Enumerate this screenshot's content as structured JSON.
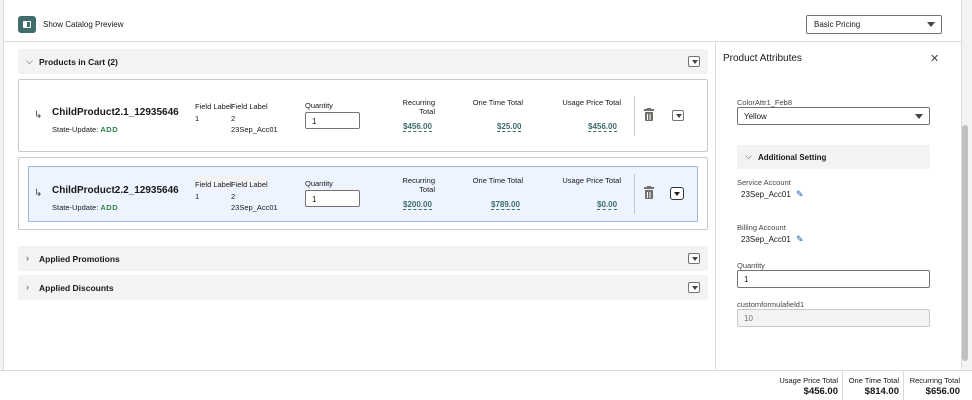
{
  "header": {
    "catalog_toggle_label": "Show Catalog Preview",
    "pricing_select_value": "Basic Pricing"
  },
  "sections": {
    "products_in_cart": "Products in Cart (2)",
    "applied_promotions": "Applied Promotions",
    "applied_discounts": "Applied Discounts"
  },
  "products": [
    {
      "name": "ChildProduct2.1_12935646",
      "state_label": "State-Update:",
      "state_value": "ADD",
      "field_label_1": "Field Label",
      "field_label_2": "Field Label",
      "field_value_1": "1",
      "field_value_2": "2",
      "field_value_3": "23Sep_Acc01",
      "quantity_label": "Quantity",
      "quantity": "1",
      "recurring_label": "Recurring Total",
      "recurring_total": "$456.00",
      "one_time_label": "One Time Total",
      "one_time_total": "$25.00",
      "usage_label": "Usage Price Total",
      "usage_total": "$456.00"
    },
    {
      "name": "ChildProduct2.2_12935646",
      "state_label": "State-Update:",
      "state_value": "ADD",
      "field_label_1": "Field Label",
      "field_label_2": "Field Label",
      "field_value_1": "1",
      "field_value_2": "2",
      "field_value_3": "23Sep_Acc01",
      "quantity_label": "Quantity",
      "quantity": "1",
      "recurring_label": "Recurring Total",
      "recurring_total": "$200.00",
      "one_time_label": "One Time Total",
      "one_time_total": "$789.00",
      "usage_label": "Usage Price Total",
      "usage_total": "$0.00"
    }
  ],
  "attributes": {
    "title": "Product Attributes",
    "color_label": "ColorAttr1_Feb8",
    "color_value": "Yellow",
    "additional_setting": "Additional Setting",
    "service_account_label": "Service Account",
    "service_account_value": "23Sep_Acc01",
    "billing_account_label": "Billing Account",
    "billing_account_value": "23Sep_Acc01",
    "quantity_label": "Quantity",
    "quantity_value": "1",
    "custom_field_label": "customformulafield1",
    "custom_field_value": "10"
  },
  "footer": {
    "usage_label": "Usage Price Total",
    "usage_value": "$456.00",
    "one_time_label": "One Time Total",
    "one_time_value": "$814.00",
    "recurring_label": "Recurring Total",
    "recurring_value": "$656.00"
  },
  "colors": {
    "accent": "#3e6d6b",
    "state_add": "#2e844a",
    "selected_bg": "#eef4ff"
  }
}
